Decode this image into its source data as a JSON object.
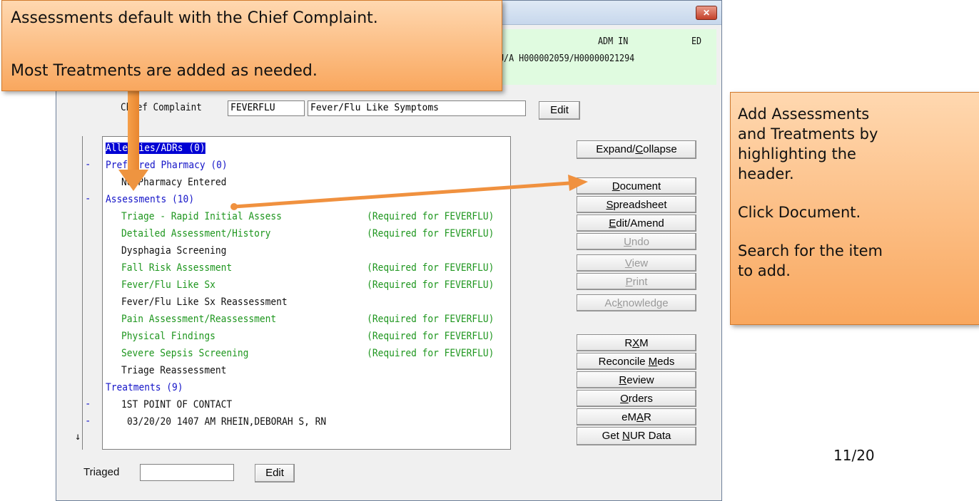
{
  "window": {
    "close_glyph": "✕"
  },
  "header": {
    "line1_left": "ADM IN",
    "line1_right": "ED",
    "line2": "U/A H000002059/H00000021294"
  },
  "chief_complaint": {
    "label_partial": "Chief Complaint",
    "code": "FEVERFLU",
    "description": "Fever/Flu Like Symptoms",
    "edit_label": "Edit"
  },
  "list": {
    "rows": [
      {
        "text": "Allergies/ADRs (0)",
        "color": "blue",
        "selected": true
      },
      {
        "text": "Preferred Pharmacy (0)",
        "color": "blue"
      },
      {
        "text": "No Pharmacy Entered",
        "color": "black",
        "indent": 1
      },
      {
        "text": "Assessments (10)",
        "color": "blue"
      },
      {
        "text": "Triage - Rapid Initial Assess",
        "color": "green",
        "indent": 1,
        "req": "(Required for FEVERFLU)"
      },
      {
        "text": "Detailed Assessment/History",
        "color": "green",
        "indent": 1,
        "req": "(Required for FEVERFLU)"
      },
      {
        "text": "Dysphagia Screening",
        "color": "black",
        "indent": 1
      },
      {
        "text": "Fall Risk Assessment",
        "color": "green",
        "indent": 1,
        "req": "(Required for FEVERFLU)"
      },
      {
        "text": "Fever/Flu Like Sx",
        "color": "green",
        "indent": 1,
        "req": "(Required for FEVERFLU)"
      },
      {
        "text": "Fever/Flu Like Sx Reassessment",
        "color": "black",
        "indent": 1
      },
      {
        "text": "Pain Assessment/Reassessment",
        "color": "green",
        "indent": 1,
        "req": "(Required for FEVERFLU)"
      },
      {
        "text": "Physical Findings",
        "color": "green",
        "indent": 1,
        "req": "(Required for FEVERFLU)"
      },
      {
        "text": "Severe Sepsis Screening",
        "color": "green",
        "indent": 1,
        "req": "(Required for FEVERFLU)"
      },
      {
        "text": "Triage Reassessment",
        "color": "black",
        "indent": 1
      },
      {
        "text": "Treatments (9)",
        "color": "blue"
      },
      {
        "text": "1ST POINT OF CONTACT",
        "color": "black",
        "indent": 1
      },
      {
        "text": "03/20/20 1407 AM RHEIN,DEBORAH S, RN",
        "color": "black",
        "indent": 2
      }
    ],
    "gutter_marks": {
      "minus": "-",
      "down_arrow": "↓"
    }
  },
  "buttons": {
    "expand_collapse": "Expand/Collapse",
    "document": "Document",
    "spreadsheet": "Spreadsheet",
    "edit_amend": "Edit/Amend",
    "undo": "Undo",
    "view": "View",
    "print": "Print",
    "acknowledge": "Acknowledge",
    "rxm": "RXM",
    "reconcile_meds": "Reconcile Meds",
    "review": "Review",
    "orders": "Orders",
    "emar": "eMAR",
    "get_nur_data": "Get NUR Data"
  },
  "triaged": {
    "label": "Triaged",
    "value": "",
    "edit_label": "Edit"
  },
  "callout_left": {
    "line1": "Assessments default with the Chief Complaint.",
    "line2": "Most Treatments are added as needed."
  },
  "callout_right": {
    "lines": [
      "Add Assessments",
      "and Treatments by",
      "highlighting the",
      "header.",
      "Click Document.",
      "Search for the item",
      "to add."
    ]
  },
  "page_number": "11/20",
  "colors": {
    "callout_fill": "#f9a75e",
    "arrow": "#f0913f",
    "blue_text": "#1414c8",
    "green_text": "#1e961e",
    "header_green": "#e0fbe0",
    "selection": "#0000d4"
  }
}
